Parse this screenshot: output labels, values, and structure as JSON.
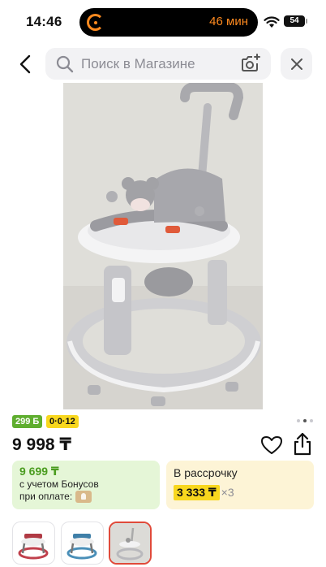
{
  "status_bar": {
    "time": "14:46",
    "activity_text": "46 мин",
    "battery": "54"
  },
  "search": {
    "placeholder": "Поиск в Магазине"
  },
  "gallery": {
    "image_count": 3,
    "active_index": 2
  },
  "badges": {
    "bonus": "299 Б",
    "installment": "0·0·12"
  },
  "product": {
    "price": "9 998 ₸"
  },
  "bonus_card": {
    "price": "9 699 ₸",
    "line1": "с учетом Бонусов",
    "line2": "при оплате:"
  },
  "installment_card": {
    "label": "В рассрочку",
    "amount": "3 333 ₸",
    "times": "×3"
  },
  "colors": {
    "accent_green": "#5fae2f",
    "accent_yellow": "#f8d71e",
    "timer_orange": "#ff8a1f",
    "selected_border": "#e04a3a"
  }
}
